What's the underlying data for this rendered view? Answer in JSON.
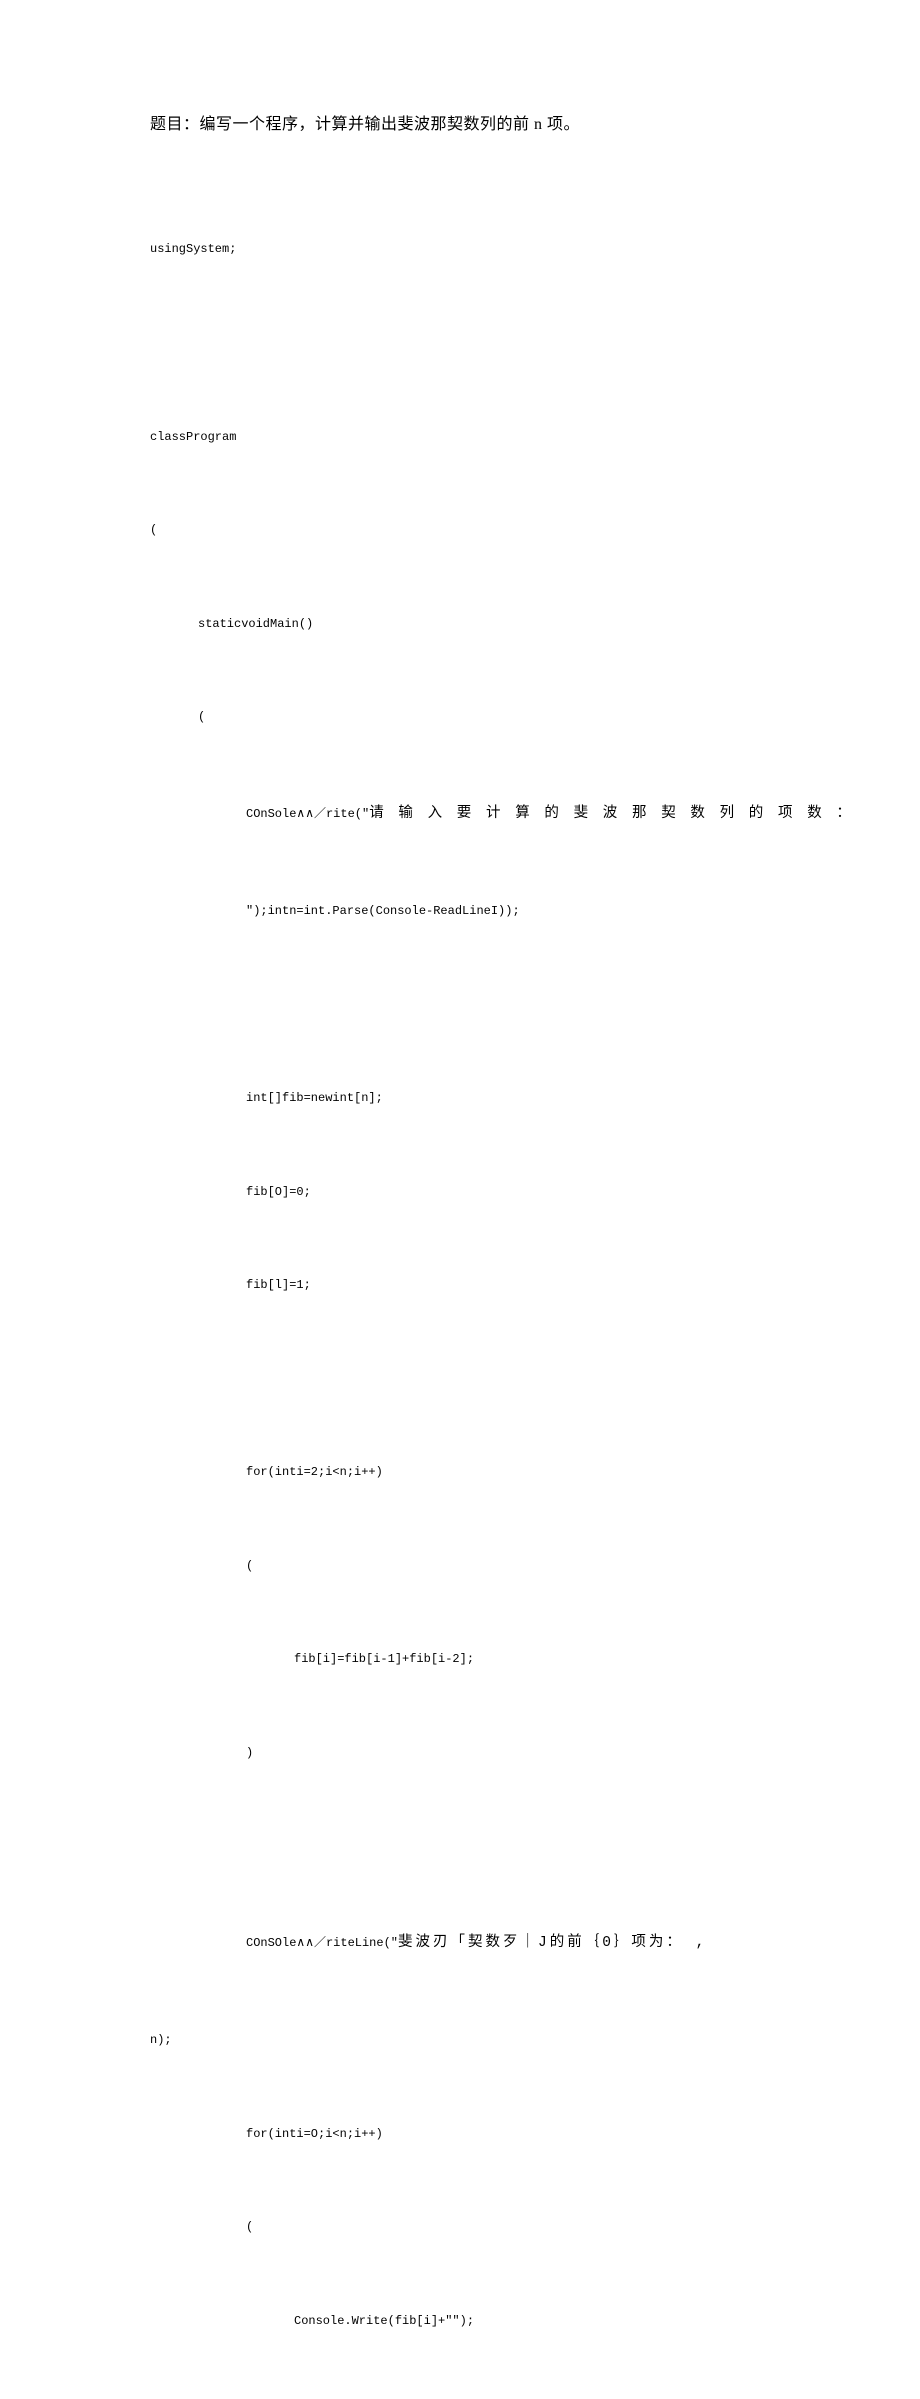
{
  "title": "题目：编写一个程序，计算并输出斐波那契数列的前 n 项。",
  "code": {
    "l01": "usingSystem;",
    "l02": "classProgram",
    "l03": "(",
    "l04": "staticvoidMain()",
    "l05": "(",
    "l06a": "COnSole∧∧／rite(\"",
    "l06b": "请 输 入 要 计 算 的 斐 波 那 契 数 列 的 项 数 ：",
    "l07": "″);intn=int.Parse(Console-ReadLineI));",
    "l08": "int[]fib=newint[n];",
    "l09": "fib[O]=0;",
    "l10": "fib[l]=1;",
    "l11": "for(inti=2;i<n;i++)",
    "l12": "(",
    "l13": "fib[i]=fib[i-1]+fib[i-2];",
    "l14": ")",
    "l15a": "COnSOle∧∧／riteLine(\"",
    "l15b": "斐波刃「契数歹｜J的前｛0｝项为： ,",
    "l16": "n);",
    "l17": "for(inti=O;i<n;i++)",
    "l18": "(",
    "l19": "Console.Write(fib[i]+\"\");"
  }
}
